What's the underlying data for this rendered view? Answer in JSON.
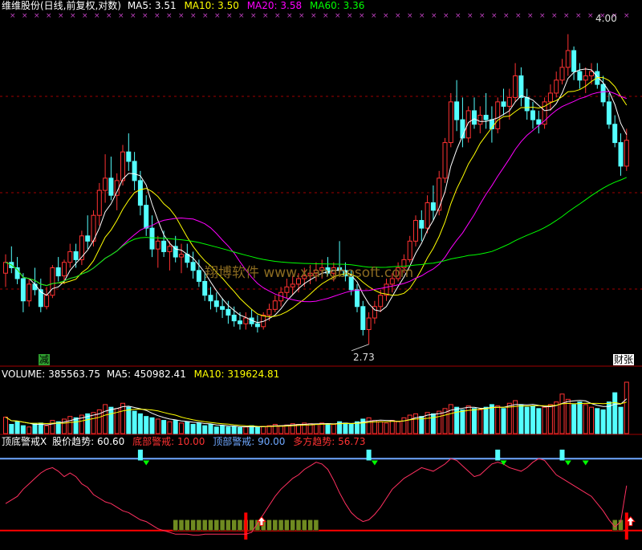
{
  "colors": {
    "up": "#ff3232",
    "down": "#54ffff",
    "ma5": "#ffffff",
    "ma10": "#ffff00",
    "ma20": "#ff00ff",
    "ma60": "#00ff00",
    "grid": "#a00000",
    "warn_line": "#6fa8ff",
    "osc": "#ff3060",
    "bottom_bar": "#6f8a20",
    "top_line": "#ff0000"
  },
  "price_panel": {
    "stock": "维维股份(日线,前复权,对数)",
    "ma5_label": "MA5:",
    "ma5_value": "3.51",
    "ma10_label": "MA10:",
    "ma10_value": "3.50",
    "ma20_label": "MA20:",
    "ma20_value": "3.58",
    "ma60_label": "MA60:",
    "ma60_value": "3.36",
    "max_label": "4.00",
    "min_label": "2.73",
    "watermark": "翔博软件  www.xiangbosoft.com",
    "tag_left": "减",
    "tag_right": "财",
    "tag_right2": "张"
  },
  "volume_panel": {
    "label": "VOLUME:",
    "value": "385563.75",
    "ma5_label": "MA5:",
    "ma5_value": "450982.41",
    "ma10_label": "MA10:",
    "ma10_value": "319624.81"
  },
  "indicator_panel": {
    "name": "顶底警戒X",
    "trend_label": "股价趋势:",
    "trend_value": "60.60",
    "bottom_label": "底部警戒:",
    "bottom_value": "10.00",
    "top_label": "顶部警戒:",
    "top_value": "90.00",
    "bull_label": "多方趋势:",
    "bull_value": "56.73"
  },
  "chart_data": {
    "type": "candlestick",
    "price_axis": "log",
    "y_max_marked": 4.0,
    "y_min_marked": 2.73,
    "candles": [
      [
        2.98,
        3.05,
        2.93,
        3.02
      ],
      [
        3.02,
        3.08,
        2.98,
        3.0
      ],
      [
        3.0,
        3.04,
        2.94,
        2.96
      ],
      [
        2.96,
        2.98,
        2.84,
        2.88
      ],
      [
        2.88,
        2.96,
        2.86,
        2.94
      ],
      [
        2.94,
        3.0,
        2.9,
        2.92
      ],
      [
        2.92,
        2.96,
        2.84,
        2.86
      ],
      [
        2.86,
        2.93,
        2.85,
        2.9
      ],
      [
        2.9,
        3.01,
        2.89,
        3.0
      ],
      [
        3.0,
        3.04,
        2.95,
        2.97
      ],
      [
        2.97,
        3.03,
        2.94,
        3.02
      ],
      [
        3.02,
        3.09,
        3.0,
        3.06
      ],
      [
        3.06,
        3.09,
        3.0,
        3.03
      ],
      [
        3.03,
        3.14,
        3.01,
        3.12
      ],
      [
        3.12,
        3.2,
        3.07,
        3.1
      ],
      [
        3.1,
        3.22,
        3.08,
        3.2
      ],
      [
        3.2,
        3.33,
        3.16,
        3.3
      ],
      [
        3.3,
        3.45,
        3.25,
        3.35
      ],
      [
        3.35,
        3.44,
        3.26,
        3.28
      ],
      [
        3.28,
        3.37,
        3.22,
        3.34
      ],
      [
        3.34,
        3.49,
        3.32,
        3.46
      ],
      [
        3.46,
        3.54,
        3.38,
        3.42
      ],
      [
        3.42,
        3.46,
        3.3,
        3.34
      ],
      [
        3.34,
        3.38,
        3.2,
        3.24
      ],
      [
        3.24,
        3.28,
        3.12,
        3.15
      ],
      [
        3.15,
        3.2,
        3.04,
        3.07
      ],
      [
        3.07,
        3.12,
        3.0,
        3.1
      ],
      [
        3.1,
        3.14,
        3.04,
        3.06
      ],
      [
        3.06,
        3.1,
        2.99,
        3.08
      ],
      [
        3.08,
        3.12,
        3.02,
        3.04
      ],
      [
        3.04,
        3.09,
        2.98,
        3.05
      ],
      [
        3.05,
        3.09,
        3.0,
        3.02
      ],
      [
        3.02,
        3.06,
        2.96,
        2.99
      ],
      [
        2.99,
        3.03,
        2.93,
        2.95
      ],
      [
        2.95,
        2.98,
        2.88,
        2.9
      ],
      [
        2.9,
        2.93,
        2.85,
        2.88
      ],
      [
        2.88,
        2.91,
        2.84,
        2.86
      ],
      [
        2.86,
        2.89,
        2.82,
        2.85
      ],
      [
        2.85,
        2.88,
        2.8,
        2.83
      ],
      [
        2.83,
        2.86,
        2.79,
        2.81
      ],
      [
        2.81,
        2.84,
        2.78,
        2.8
      ],
      [
        2.8,
        2.84,
        2.78,
        2.82
      ],
      [
        2.82,
        2.85,
        2.79,
        2.8
      ],
      [
        2.8,
        2.83,
        2.77,
        2.79
      ],
      [
        2.79,
        2.84,
        2.78,
        2.83
      ],
      [
        2.83,
        2.87,
        2.81,
        2.85
      ],
      [
        2.85,
        2.9,
        2.84,
        2.88
      ],
      [
        2.88,
        2.93,
        2.86,
        2.91
      ],
      [
        2.91,
        2.96,
        2.89,
        2.93
      ],
      [
        2.93,
        2.97,
        2.9,
        2.94
      ],
      [
        2.94,
        2.98,
        2.91,
        2.96
      ],
      [
        2.96,
        3.0,
        2.93,
        2.97
      ],
      [
        2.97,
        3.01,
        2.94,
        2.98
      ],
      [
        2.98,
        3.02,
        2.95,
        2.99
      ],
      [
        2.99,
        3.03,
        2.96,
        3.0
      ],
      [
        3.0,
        3.04,
        2.97,
        2.98
      ],
      [
        2.98,
        3.02,
        2.95,
        3.0
      ],
      [
        3.0,
        3.1,
        2.97,
        2.99
      ],
      [
        2.99,
        3.02,
        2.95,
        2.97
      ],
      [
        2.97,
        2.99,
        2.9,
        2.92
      ],
      [
        2.92,
        2.94,
        2.84,
        2.86
      ],
      [
        2.86,
        2.88,
        2.76,
        2.78
      ],
      [
        2.78,
        2.84,
        2.73,
        2.82
      ],
      [
        2.82,
        2.88,
        2.8,
        2.86
      ],
      [
        2.86,
        2.92,
        2.84,
        2.9
      ],
      [
        2.9,
        2.96,
        2.88,
        2.94
      ],
      [
        2.94,
        2.98,
        2.91,
        2.96
      ],
      [
        2.96,
        3.02,
        2.95,
        3.0
      ],
      [
        3.0,
        3.05,
        2.98,
        3.03
      ],
      [
        3.03,
        3.12,
        3.02,
        3.1
      ],
      [
        3.1,
        3.2,
        3.08,
        3.18
      ],
      [
        3.18,
        3.22,
        3.1,
        3.15
      ],
      [
        3.15,
        3.28,
        3.13,
        3.25
      ],
      [
        3.25,
        3.32,
        3.18,
        3.22
      ],
      [
        3.22,
        3.38,
        3.2,
        3.35
      ],
      [
        3.35,
        3.52,
        3.33,
        3.5
      ],
      [
        3.5,
        3.72,
        3.48,
        3.68
      ],
      [
        3.68,
        3.78,
        3.55,
        3.6
      ],
      [
        3.6,
        3.7,
        3.48,
        3.52
      ],
      [
        3.52,
        3.66,
        3.5,
        3.64
      ],
      [
        3.64,
        3.7,
        3.56,
        3.58
      ],
      [
        3.58,
        3.66,
        3.54,
        3.62
      ],
      [
        3.62,
        3.72,
        3.56,
        3.6
      ],
      [
        3.6,
        3.66,
        3.5,
        3.56
      ],
      [
        3.56,
        3.7,
        3.54,
        3.68
      ],
      [
        3.68,
        3.74,
        3.62,
        3.66
      ],
      [
        3.66,
        3.74,
        3.6,
        3.7
      ],
      [
        3.7,
        3.86,
        3.68,
        3.8
      ],
      [
        3.8,
        3.84,
        3.66,
        3.7
      ],
      [
        3.7,
        3.74,
        3.6,
        3.64
      ],
      [
        3.64,
        3.68,
        3.56,
        3.6
      ],
      [
        3.6,
        3.64,
        3.54,
        3.58
      ],
      [
        3.58,
        3.7,
        3.56,
        3.68
      ],
      [
        3.68,
        3.76,
        3.64,
        3.72
      ],
      [
        3.72,
        3.82,
        3.7,
        3.78
      ],
      [
        3.78,
        3.88,
        3.76,
        3.84
      ],
      [
        3.84,
        4.0,
        3.8,
        3.92
      ],
      [
        3.92,
        3.94,
        3.78,
        3.82
      ],
      [
        3.82,
        3.86,
        3.74,
        3.78
      ],
      [
        3.78,
        3.84,
        3.72,
        3.8
      ],
      [
        3.8,
        3.86,
        3.76,
        3.82
      ],
      [
        3.82,
        3.86,
        3.74,
        3.76
      ],
      [
        3.76,
        3.8,
        3.66,
        3.68
      ],
      [
        3.68,
        3.72,
        3.56,
        3.58
      ],
      [
        3.58,
        3.62,
        3.48,
        3.5
      ],
      [
        3.5,
        3.54,
        3.36,
        3.4
      ],
      [
        3.4,
        3.56,
        3.38,
        3.51
      ]
    ],
    "volume": [
      25,
      14,
      18,
      12,
      10,
      15,
      16,
      12,
      20,
      18,
      22,
      26,
      24,
      28,
      30,
      32,
      36,
      44,
      40,
      38,
      46,
      40,
      34,
      30,
      26,
      24,
      22,
      20,
      18,
      20,
      16,
      18,
      14,
      16,
      12,
      14,
      10,
      12,
      10,
      11,
      9,
      10,
      12,
      10,
      11,
      12,
      14,
      12,
      13,
      15,
      14,
      16,
      15,
      14,
      16,
      15,
      14,
      18,
      16,
      14,
      18,
      22,
      24,
      20,
      18,
      16,
      20,
      18,
      24,
      28,
      30,
      26,
      32,
      30,
      34,
      38,
      44,
      40,
      36,
      42,
      38,
      36,
      40,
      44,
      42,
      38,
      46,
      50,
      44,
      40,
      42,
      38,
      40,
      44,
      48,
      60,
      52,
      44,
      48,
      44,
      40,
      38,
      36,
      48,
      62,
      40,
      78
    ],
    "indicator_panel": {
      "name": "顶底警戒X",
      "series": [
        {
          "name": "股价趋势",
          "last": 60.6
        },
        {
          "name": "底部警戒",
          "value": 10.0
        },
        {
          "name": "顶部警戒",
          "value": 90.0
        },
        {
          "name": "多方趋势",
          "last": 56.73
        }
      ],
      "trend": [
        40,
        44,
        48,
        56,
        62,
        68,
        74,
        78,
        80,
        76,
        70,
        74,
        70,
        62,
        58,
        50,
        46,
        42,
        40,
        36,
        32,
        30,
        26,
        22,
        20,
        16,
        12,
        10,
        8,
        6,
        6,
        6,
        5,
        5,
        6,
        6,
        6,
        6,
        6,
        6,
        6,
        6,
        8,
        18,
        28,
        38,
        48,
        56,
        62,
        68,
        72,
        78,
        82,
        86,
        84,
        78,
        66,
        52,
        40,
        30,
        24,
        20,
        22,
        28,
        36,
        46,
        56,
        62,
        68,
        72,
        76,
        80,
        78,
        76,
        80,
        84,
        90,
        88,
        82,
        76,
        70,
        72,
        78,
        84,
        86,
        84,
        80,
        78,
        76,
        80,
        86,
        90,
        88,
        80,
        72,
        68,
        64,
        60,
        56,
        52,
        48,
        40,
        32,
        22,
        14,
        20,
        60
      ],
      "sell_signals": [
        23,
        62,
        84,
        95
      ],
      "buy_signals": [
        24,
        63,
        85,
        96,
        99
      ],
      "bottom_bars": [
        29,
        30,
        31,
        32,
        33,
        34,
        35,
        36,
        37,
        38,
        39,
        40,
        41,
        42,
        43,
        44,
        45,
        46,
        47,
        48,
        49,
        50,
        51,
        52,
        53,
        104,
        105
      ]
    }
  }
}
